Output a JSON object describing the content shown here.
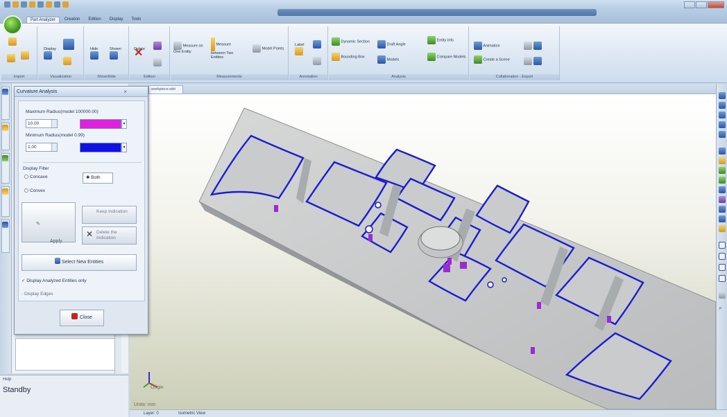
{
  "window": {
    "title": "",
    "menu_tabs": [
      "Part Analyzer",
      "Creation",
      "Edition",
      "Display",
      "Tools"
    ]
  },
  "ribbon": {
    "groups": [
      {
        "label": "Import"
      },
      {
        "label": "Visualization",
        "buttons": [
          "Display"
        ]
      },
      {
        "label": "Show/Hide",
        "buttons": [
          "Hide",
          "Shown"
        ]
      },
      {
        "label": "Edition",
        "buttons": [
          "Delete"
        ]
      },
      {
        "label": "Measurements",
        "buttons": [
          "Measure on One Entity",
          "Measure between Two Entities",
          "Model Points"
        ]
      },
      {
        "label": "Annotation",
        "buttons": [
          "Label"
        ]
      },
      {
        "label": "Analysis",
        "buttons": [
          "Dynamic Section",
          "Bounding Box",
          "Draft Angle",
          "Models",
          "Entity Info",
          "Compare Models"
        ]
      },
      {
        "label": "Collaboration - Export",
        "buttons": [
          "Animation",
          "Create a Scene"
        ]
      }
    ]
  },
  "dialog": {
    "title": "Curvature Analysis",
    "max_label": "Maximum Radius(model 100000.00)",
    "max_value": "10.00",
    "max_color": "#e020e0",
    "min_label": "Minimum Radius(model 0.99)",
    "min_value": "1.00",
    "min_color": "#1010e8",
    "filter_label": "Display Filter",
    "opt_concave": "Concave",
    "opt_convex": "Convex",
    "opt_both": "Both",
    "apply": "Apply",
    "keep": "Keep Indication",
    "delete": "Delete the Indication",
    "select_new": "Select New Entities",
    "display_analyzed": "Display Analyzed Entities only",
    "display_edges": "Display Edges",
    "close": "Close"
  },
  "help": {
    "label": "Help",
    "status": "Standby"
  },
  "document": {
    "tab": "workpiece.wbt"
  },
  "viewport": {
    "units": "Units: mm",
    "origin": "Origin"
  },
  "statusbar": {
    "layer": "Layer: 0",
    "view": "Isometric View"
  }
}
